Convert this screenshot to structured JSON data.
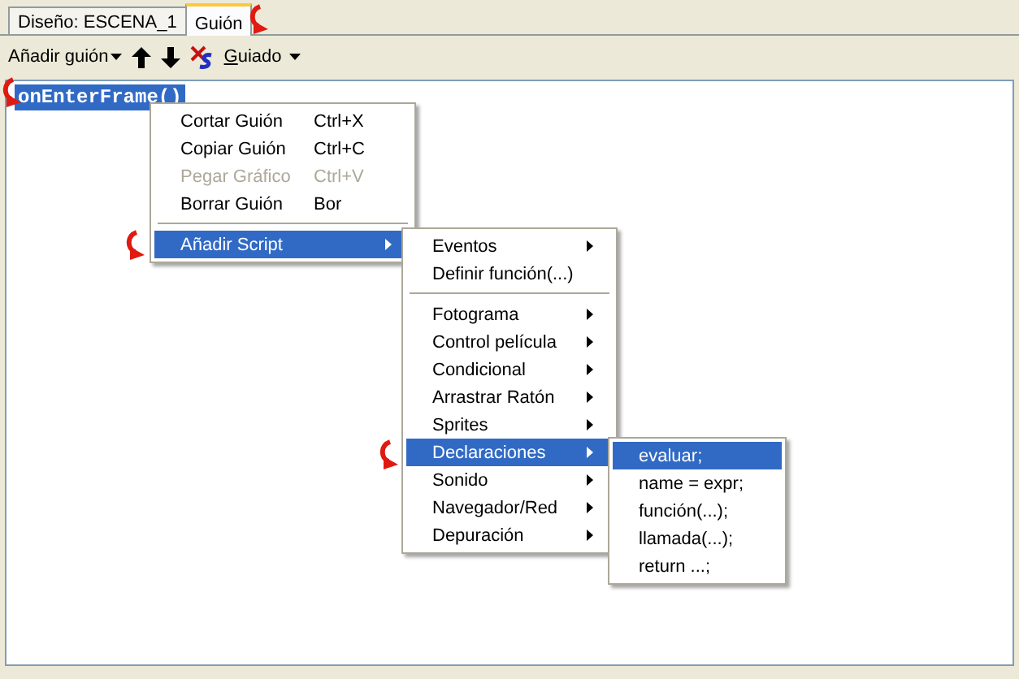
{
  "tabs": [
    {
      "label": "Diseño: ESCENA_1",
      "selected": false
    },
    {
      "label": "Guión",
      "selected": true
    }
  ],
  "toolbar": {
    "add_script": "Añadir guión",
    "guided": "Guiado"
  },
  "editor": {
    "lines": [
      {
        "text": "onEnterFrame()",
        "selected": true
      }
    ]
  },
  "menus": [
    {
      "items": [
        {
          "kind": "item",
          "label": "Cortar Guión",
          "shortcut": "Ctrl+X",
          "disabled": false,
          "selected": false,
          "submenu": false
        },
        {
          "kind": "item",
          "label": "Copiar Guión",
          "shortcut": "Ctrl+C",
          "disabled": false,
          "selected": false,
          "submenu": false
        },
        {
          "kind": "item",
          "label": "Pegar Gráfico",
          "shortcut": "Ctrl+V",
          "disabled": true,
          "selected": false,
          "submenu": false
        },
        {
          "kind": "item",
          "label": "Borrar Guión",
          "shortcut": "Bor",
          "disabled": false,
          "selected": false,
          "submenu": false
        },
        {
          "kind": "separator"
        },
        {
          "kind": "item",
          "label": "Añadir Script",
          "disabled": false,
          "selected": true,
          "submenu": true
        }
      ]
    },
    {
      "items": [
        {
          "kind": "item",
          "label": "Eventos",
          "disabled": false,
          "selected": false,
          "submenu": true
        },
        {
          "kind": "item",
          "label": "Definir función(...)",
          "disabled": false,
          "selected": false,
          "submenu": false
        },
        {
          "kind": "separator"
        },
        {
          "kind": "item",
          "label": "Fotograma",
          "disabled": false,
          "selected": false,
          "submenu": true
        },
        {
          "kind": "item",
          "label": "Control película",
          "disabled": false,
          "selected": false,
          "submenu": true
        },
        {
          "kind": "item",
          "label": "Condicional",
          "disabled": false,
          "selected": false,
          "submenu": true
        },
        {
          "kind": "item",
          "label": "Arrastrar Ratón",
          "disabled": false,
          "selected": false,
          "submenu": true
        },
        {
          "kind": "item",
          "label": "Sprites",
          "disabled": false,
          "selected": false,
          "submenu": true
        },
        {
          "kind": "item",
          "label": "Declaraciones",
          "disabled": false,
          "selected": true,
          "submenu": true
        },
        {
          "kind": "item",
          "label": "Sonido",
          "disabled": false,
          "selected": false,
          "submenu": true
        },
        {
          "kind": "item",
          "label": "Navegador/Red",
          "disabled": false,
          "selected": false,
          "submenu": true
        },
        {
          "kind": "item",
          "label": "Depuración",
          "disabled": false,
          "selected": false,
          "submenu": true
        }
      ]
    },
    {
      "items": [
        {
          "kind": "item",
          "label": "evaluar;",
          "disabled": false,
          "selected": true,
          "submenu": false
        },
        {
          "kind": "item",
          "label": "name = expr;",
          "disabled": false,
          "selected": false,
          "submenu": false
        },
        {
          "kind": "item",
          "label": "función(...);",
          "disabled": false,
          "selected": false,
          "submenu": false
        },
        {
          "kind": "item",
          "label": "llamada(...);",
          "disabled": false,
          "selected": false,
          "submenu": false
        },
        {
          "kind": "item",
          "label": "return ...;",
          "disabled": false,
          "selected": false,
          "submenu": false
        }
      ]
    }
  ]
}
